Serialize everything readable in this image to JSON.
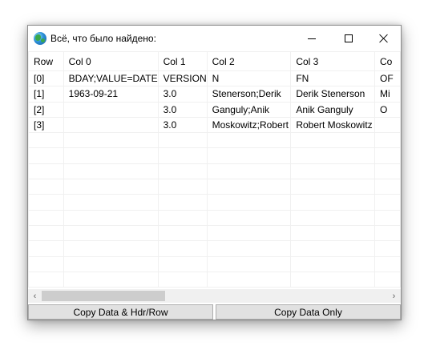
{
  "window": {
    "title": "Всё, что было найдено:",
    "icon": "globe-icon"
  },
  "grid": {
    "columns": [
      "Row",
      "Col 0",
      "Col 1",
      "Col 2",
      "Col 3",
      "Co"
    ],
    "rows": [
      [
        "[0]",
        "BDAY;VALUE=DATE",
        "VERSION",
        "N",
        "FN",
        "OF"
      ],
      [
        "[1]",
        "1963-09-21",
        "3.0",
        "Stenerson;Derik",
        "Derik Stenerson",
        "Mi"
      ],
      [
        "[2]",
        "",
        "3.0",
        "Ganguly;Anik",
        "Anik Ganguly",
        " O"
      ],
      [
        "[3]",
        "",
        "3.0",
        "Moskowitz;Robert",
        "Robert Moskowitz",
        ""
      ]
    ],
    "empty_rows": 10
  },
  "scrollbar": {
    "left_arrow": "‹",
    "right_arrow": "›"
  },
  "buttons": {
    "copy_with_header": "Copy Data & Hdr/Row",
    "copy_data_only": "Copy Data Only"
  }
}
